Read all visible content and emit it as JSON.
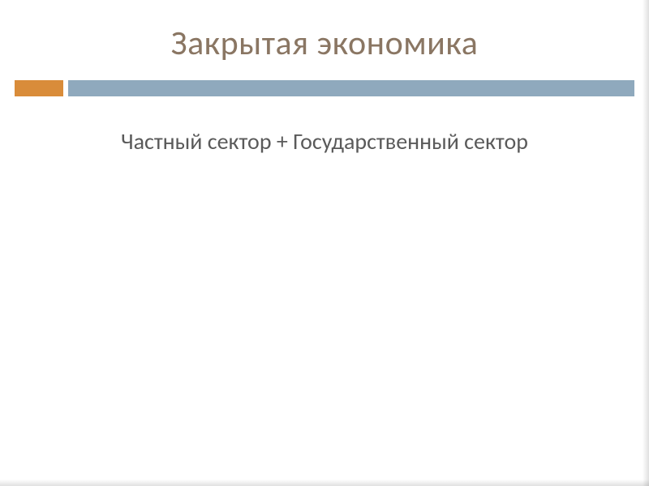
{
  "slide": {
    "title": "Закрытая экономика",
    "content": "Частный сектор + Государственный сектор"
  },
  "colors": {
    "title_color": "#8a7663",
    "accent_block": "#d98c3a",
    "divider_bar": "#8fa9bd",
    "content_text": "#5a5a5a"
  }
}
